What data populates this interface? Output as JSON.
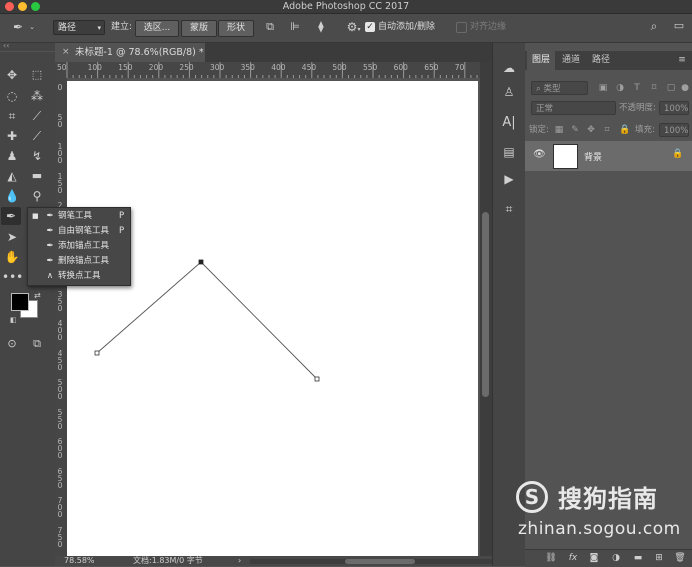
{
  "window": {
    "title": "Adobe Photoshop CC 2017"
  },
  "options_bar": {
    "mode_select": "路径",
    "make_label": "建立:",
    "selection_button": "选区...",
    "mask_button": "蒙版",
    "shape_button": "形状",
    "auto_add_delete_label": "自动添加/删除",
    "auto_add_delete_checked": true,
    "align_edges_label": "对齐边缘",
    "align_edges_checked": false
  },
  "document": {
    "tab_title": "未标题-1 @ 78.6%(RGB/8) *",
    "zoom": "78.58%",
    "doc_info": "文档:1.83M/0 字节"
  },
  "ruler": {
    "h_labels": [
      "50",
      "100",
      "150",
      "200",
      "250",
      "300",
      "350",
      "400",
      "450",
      "500",
      "550",
      "600",
      "650",
      "70"
    ],
    "v_labels": [
      "0",
      "5 0",
      "1 0 0",
      "1 5 0",
      "2 0 0",
      "2 5 0",
      "3 0 0",
      "3 5 0",
      "4 0 0",
      "4 5 0",
      "5 0 0",
      "5 5 0",
      "6 0 0",
      "6 5 0",
      "7 0 0",
      "7 5 0"
    ]
  },
  "pen_flyout": {
    "items": [
      {
        "label": "钢笔工具",
        "shortcut": "P",
        "active": true,
        "icon": "pen-icon"
      },
      {
        "label": "自由钢笔工具",
        "shortcut": "P",
        "active": false,
        "icon": "freeform-pen-icon"
      },
      {
        "label": "添加锚点工具",
        "shortcut": "",
        "active": false,
        "icon": "add-anchor-icon"
      },
      {
        "label": "删除锚点工具",
        "shortcut": "",
        "active": false,
        "icon": "delete-anchor-icon"
      },
      {
        "label": "转换点工具",
        "shortcut": "",
        "active": false,
        "icon": "convert-point-icon"
      }
    ]
  },
  "layers_panel": {
    "tabs": [
      "图层",
      "通道",
      "路径"
    ],
    "active_tab": "图层",
    "filter_placeholder": "类型",
    "blend_mode": "正常",
    "opacity_label": "不透明度:",
    "opacity_value": "100%",
    "lock_label": "锁定:",
    "fill_label": "填充:",
    "fill_value": "100%",
    "layers": [
      {
        "name": "背景",
        "visible": true,
        "locked": true
      }
    ]
  },
  "watermark": {
    "logo_letter": "S",
    "name": "搜狗指南",
    "url": "zhinan.sogou.com"
  },
  "colors": {
    "foreground": "#000000",
    "background": "#ffffff",
    "accent_close": "#ff5f57",
    "accent_min": "#febc2e",
    "accent_max": "#28c840"
  }
}
